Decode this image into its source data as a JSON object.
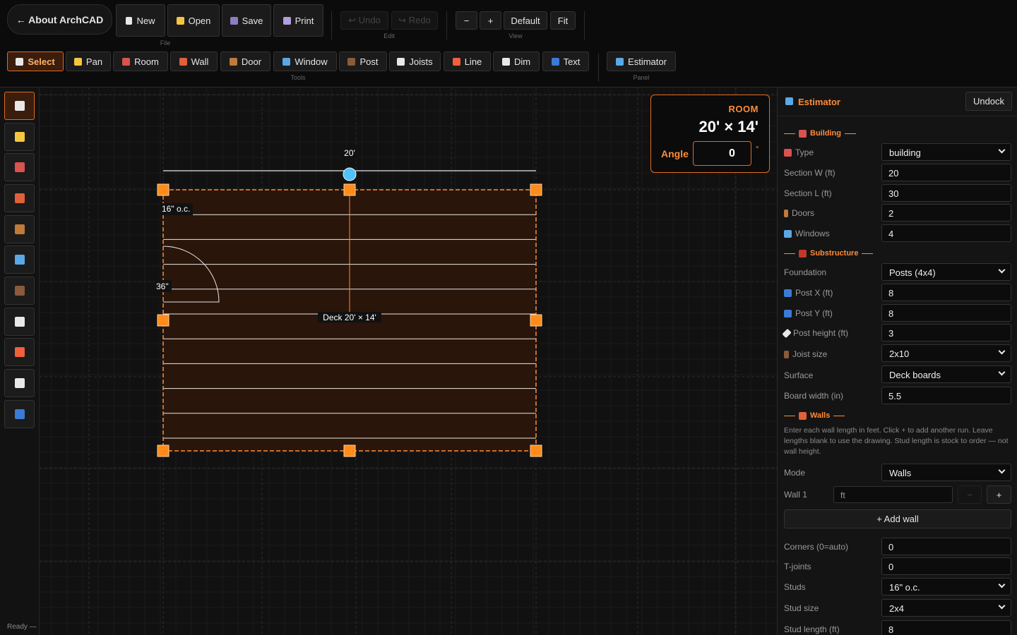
{
  "toolbar": {
    "about": "← About ArchCAD",
    "file": {
      "new": "New",
      "open": "Open",
      "save": "Save",
      "print": "Print",
      "label": "File"
    },
    "edit": {
      "undo": "↩ Undo",
      "redo": "↪ Redo",
      "label": "Edit"
    },
    "view": {
      "zoom_out": "−",
      "zoom_in": "+",
      "default": "Default",
      "fit": "Fit",
      "label": "View"
    },
    "tools": {
      "label": "Tools",
      "items": [
        {
          "label": "Select",
          "icon": "cursor-icon",
          "color": "#e8e8e8",
          "active": true
        },
        {
          "label": "Pan",
          "icon": "hand-icon",
          "color": "#f5c542"
        },
        {
          "label": "Room",
          "icon": "house-icon",
          "color": "#d9534f"
        },
        {
          "label": "Wall",
          "icon": "brick-icon",
          "color": "#e0603a"
        },
        {
          "label": "Door",
          "icon": "door-icon",
          "color": "#c07a3a"
        },
        {
          "label": "Window",
          "icon": "window-icon",
          "color": "#5aa9e6"
        },
        {
          "label": "Post",
          "icon": "post-icon",
          "color": "#8a5a3a"
        },
        {
          "label": "Joists",
          "icon": "triangle-ruler-icon",
          "color": "#e8e8e8"
        },
        {
          "label": "Line",
          "icon": "pencil-icon",
          "color": "#f0603a"
        },
        {
          "label": "Dim",
          "icon": "ruler-icon",
          "color": "#e8e8e8"
        },
        {
          "label": "Text",
          "icon": "abc-icon",
          "color": "#3a7bd5"
        }
      ]
    },
    "panel": {
      "estimator": "Estimator",
      "label": "Panel"
    }
  },
  "canvas": {
    "top_dimension": "20'",
    "joist_spacing": "16\" o.c.",
    "door_width": "36\"",
    "deck_label": "Deck  20' × 14'"
  },
  "room_panel": {
    "title": "ROOM",
    "size": "20' × 14'",
    "angle_label": "Angle",
    "angle_value": "0",
    "angle_unit": "°"
  },
  "status": "Ready —",
  "estimator": {
    "title": "Estimator",
    "undock": "Undock",
    "building": {
      "heading": "Building",
      "type_label": "Type",
      "type_value": "building",
      "section_w_label": "Section W (ft)",
      "section_w_value": "20",
      "section_l_label": "Section L (ft)",
      "section_l_value": "30",
      "doors_label": "Doors",
      "doors_value": "2",
      "windows_label": "Windows",
      "windows_value": "4"
    },
    "substructure": {
      "heading": "Substructure",
      "foundation_label": "Foundation",
      "foundation_value": "Posts (4x4)",
      "post_x_label": "Post X (ft)",
      "post_x_value": "8",
      "post_y_label": "Post Y (ft)",
      "post_y_value": "8",
      "post_height_label": "Post height (ft)",
      "post_height_value": "3",
      "joist_size_label": "Joist size",
      "joist_size_value": "2x10",
      "surface_label": "Surface",
      "surface_value": "Deck boards",
      "board_width_label": "Board width (in)",
      "board_width_value": "5.5"
    },
    "walls": {
      "heading": "Walls",
      "help": "Enter each wall length in feet. Click + to add another run. Leave lengths blank to use the drawing. Stud length is stock to order — not wall height.",
      "mode_label": "Mode",
      "mode_value": "Walls",
      "wall1_label": "Wall 1",
      "wall1_placeholder": "ft",
      "minus": "−",
      "plus": "+",
      "add_wall": "+ Add wall",
      "corners_label": "Corners (0=auto)",
      "corners_value": "0",
      "tjoints_label": "T-joints",
      "tjoints_value": "0",
      "studs_label": "Studs",
      "studs_value": "16\" o.c.",
      "stud_size_label": "Stud size",
      "stud_size_value": "2x4",
      "stud_length_label": "Stud length (ft)",
      "stud_length_value": "8"
    }
  },
  "colors": {
    "accent": "#e06b22",
    "accent_text": "#ff8c38",
    "handle": "#ff8c1a",
    "rotate_handle": "#4fc3f7",
    "deck_fill": "#2a150a"
  }
}
